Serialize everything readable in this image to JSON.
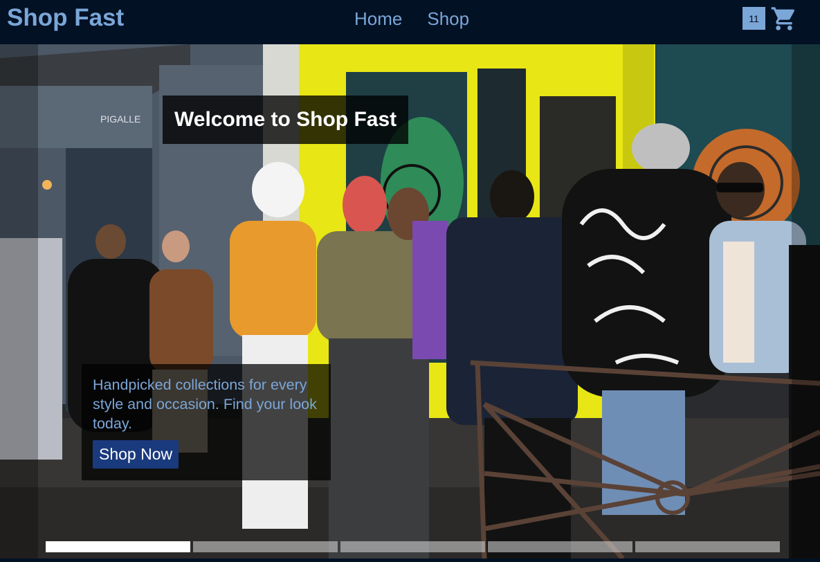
{
  "brand": {
    "name": "Shop Fast"
  },
  "nav": {
    "links": [
      {
        "label": "Home"
      },
      {
        "label": "Shop"
      }
    ]
  },
  "cart": {
    "count": "11",
    "icon": "shopping-cart-icon"
  },
  "hero": {
    "welcome": "Welcome to Shop Fast",
    "tagline": "Handpicked collections for every style and occasion. Find your look today.",
    "cta_label": "Shop Now",
    "storefront_sign": "PIGALLE",
    "slides": {
      "count": 5,
      "active_index": 0
    }
  },
  "colors": {
    "nav_background": "#021124",
    "brand_accent": "#7ba6d8",
    "cta_background": "#1a3a7e",
    "storefront_yellow": "#e8e615"
  }
}
